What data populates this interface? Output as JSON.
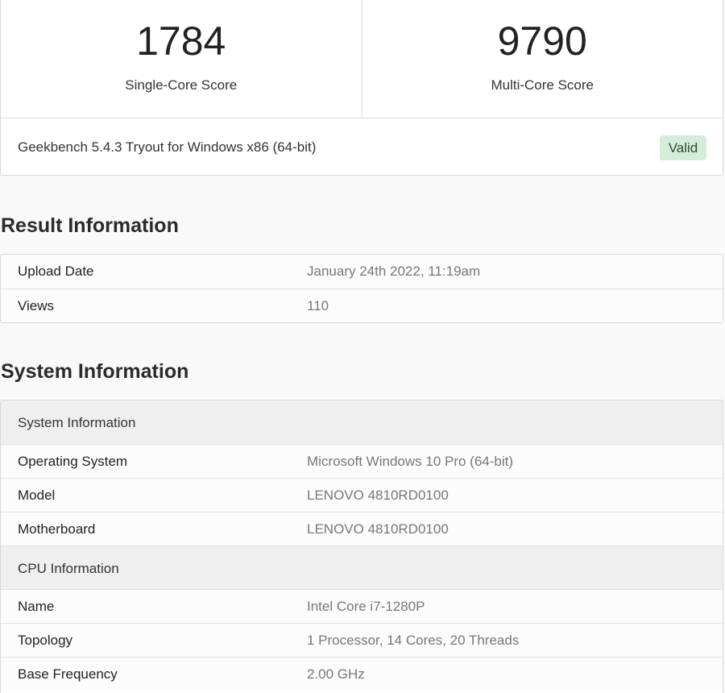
{
  "scores": {
    "single_core": {
      "value": "1784",
      "label": "Single-Core Score"
    },
    "multi_core": {
      "value": "9790",
      "label": "Multi-Core Score"
    }
  },
  "version": {
    "text": "Geekbench 5.4.3 Tryout for Windows x86 (64-bit)",
    "badge": "Valid",
    "badge_color": "#d4ecd9"
  },
  "result_info": {
    "heading": "Result Information",
    "rows": [
      {
        "label": "Upload Date",
        "value": "January 24th 2022, 11:19am"
      },
      {
        "label": "Views",
        "value": "110"
      }
    ]
  },
  "system_info": {
    "heading": "System Information",
    "groups": [
      {
        "title": "System Information",
        "rows": [
          {
            "label": "Operating System",
            "value": "Microsoft Windows 10 Pro (64-bit)"
          },
          {
            "label": "Model",
            "value": "LENOVO 4810RD0100"
          },
          {
            "label": "Motherboard",
            "value": "LENOVO 4810RD0100"
          }
        ]
      },
      {
        "title": "CPU Information",
        "rows": [
          {
            "label": "Name",
            "value": "Intel Core i7-1280P"
          },
          {
            "label": "Topology",
            "value": "1 Processor, 14 Cores, 20 Threads"
          },
          {
            "label": "Base Frequency",
            "value": "2.00 GHz"
          }
        ]
      }
    ]
  }
}
